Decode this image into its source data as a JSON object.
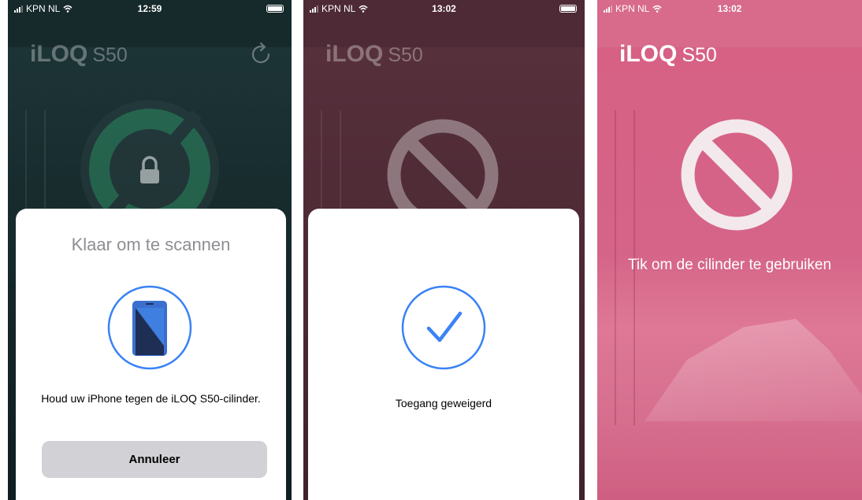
{
  "screens": [
    {
      "status": {
        "carrier": "KPN NL",
        "time": "12:59"
      },
      "logo": {
        "brand": "iLOQ",
        "model": "S50"
      },
      "sheet": {
        "title": "Klaar om te scannen",
        "message": "Houd uw iPhone tegen de iLOQ S50-cilinder.",
        "cancel_label": "Annuleer"
      }
    },
    {
      "status": {
        "carrier": "KPN NL",
        "time": "13:02"
      },
      "logo": {
        "brand": "iLOQ",
        "model": "S50"
      },
      "sheet": {
        "message": "Toegang geweigerd"
      }
    },
    {
      "status": {
        "carrier": "KPN NL",
        "time": "13:02"
      },
      "logo": {
        "brand": "iLOQ",
        "model": "S50"
      },
      "caption": "Tik om de cilinder te gebruiken"
    }
  ],
  "colors": {
    "accent_blue": "#3a82f7",
    "screen1_bg": "#16292b",
    "screen2_bg": "#4d2a35",
    "screen3_bg": "#d86a8c",
    "lock_green": "#2f8f66"
  },
  "icons": [
    "signal-icon",
    "wifi-icon",
    "battery-icon",
    "refresh-icon",
    "lock-icon",
    "phone-icon",
    "checkmark-icon",
    "no-entry-icon"
  ]
}
